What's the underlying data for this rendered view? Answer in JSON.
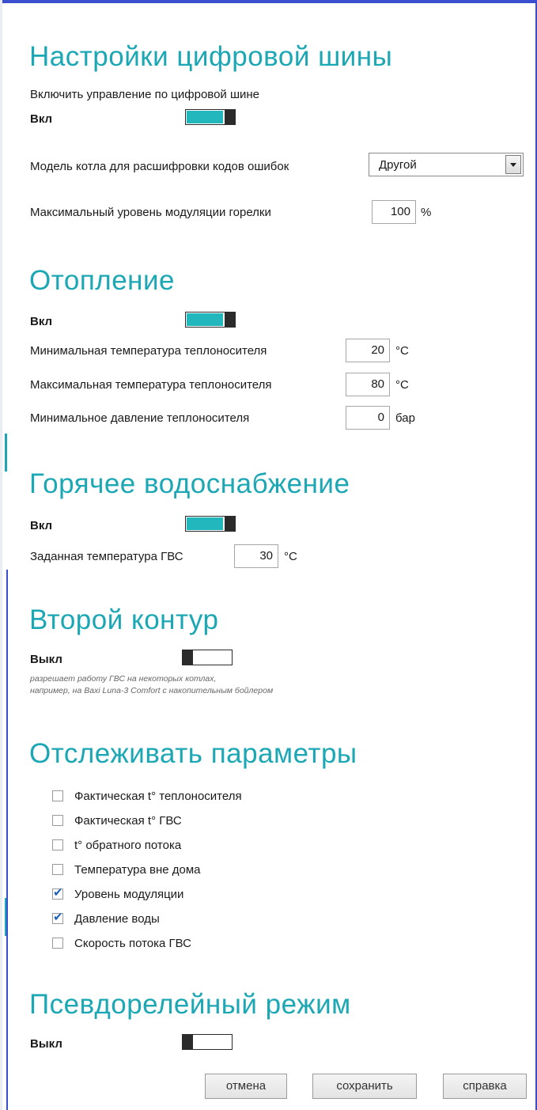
{
  "digital_bus": {
    "title": "Настройки цифровой шины",
    "enable_label": "Включить управление по цифровой шине",
    "state_label": "Вкл",
    "boiler_model_label": "Модель котла для расшифровки кодов ошибок",
    "boiler_model_value": "Другой",
    "modulation_label": "Максимальный уровень модуляции горелки",
    "modulation_value": "100",
    "modulation_unit": "%"
  },
  "heating": {
    "title": "Отопление",
    "state_label": "Вкл",
    "min_temp_label": "Минимальная температура теплоносителя",
    "min_temp_value": "20",
    "min_temp_unit": "°C",
    "max_temp_label": "Максимальная температура теплоносителя",
    "max_temp_value": "80",
    "max_temp_unit": "°C",
    "min_pressure_label": "Минимальное давление теплоносителя",
    "min_pressure_value": "0",
    "min_pressure_unit": "бар"
  },
  "hot_water": {
    "title": "Горячее водоснабжение",
    "state_label": "Вкл",
    "set_temp_label": "Заданная температура ГВС",
    "set_temp_value": "30",
    "set_temp_unit": "°C"
  },
  "second_circuit": {
    "title": "Второй контур",
    "state_label": "Выкл",
    "note_line1": "разрешает работу ГВС на некоторых котлах,",
    "note_line2": "например, на Baxi Luna-3 Comfort с накопительным бойлером"
  },
  "monitor": {
    "title": "Отслеживать параметры",
    "items": [
      {
        "label": "Фактическая t° теплоносителя",
        "checked": false
      },
      {
        "label": "Фактическая t° ГВС",
        "checked": false
      },
      {
        "label": "t° обратного потока",
        "checked": false
      },
      {
        "label": "Температура вне дома",
        "checked": false
      },
      {
        "label": "Уровень модуляции",
        "checked": true
      },
      {
        "label": "Давление воды",
        "checked": true
      },
      {
        "label": "Скорость потока ГВС",
        "checked": false
      }
    ]
  },
  "pseudo_relay": {
    "title": "Псевдорелейный режим",
    "state_label": "Выкл"
  },
  "buttons": {
    "cancel": "отмена",
    "save": "сохранить",
    "help": "справка"
  },
  "colors": {
    "accent": "#1ca7b5",
    "toggle_on": "#22b6bd",
    "frame": "#3a4fd0"
  }
}
